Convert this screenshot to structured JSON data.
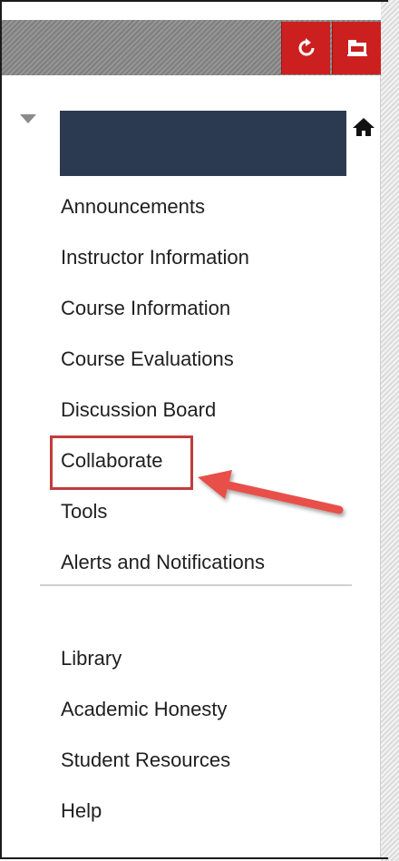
{
  "menu": {
    "course_title": "",
    "items": [
      {
        "label": "Announcements"
      },
      {
        "label": "Instructor Information"
      },
      {
        "label": "Course Information"
      },
      {
        "label": "Course Evaluations"
      },
      {
        "label": "Discussion Board"
      },
      {
        "label": "Collaborate"
      },
      {
        "label": "Tools"
      },
      {
        "label": "Alerts and Notifications"
      }
    ],
    "secondary_items": [
      {
        "label": "Library"
      },
      {
        "label": "Academic Honesty"
      },
      {
        "label": "Student Resources"
      },
      {
        "label": "Help"
      }
    ]
  },
  "toolbar": {
    "refresh_icon": "refresh-icon",
    "folders_icon": "folder-icon"
  },
  "colors": {
    "toolbar_button": "#cc1f1f",
    "course_title_box": "#2c3a51",
    "annotation": "#c23b3b",
    "arrow": "#e8504a"
  }
}
